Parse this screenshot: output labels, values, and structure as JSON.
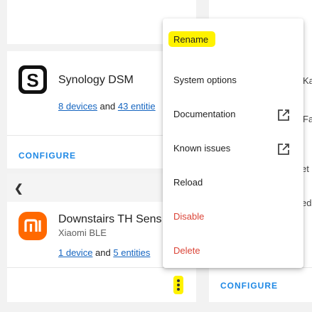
{
  "cards": {
    "synology": {
      "title": "Synology DSM",
      "devices_link": "8 devices",
      "and": "and",
      "entities_link": "43 entitie",
      "configure": "CONFIGURE"
    },
    "xiaomi": {
      "title": "Downstairs TH Sens",
      "subtitle": "Xiaomi BLE",
      "devices_link": "1 device",
      "and": "and",
      "entities_link": "5 entities"
    },
    "right": {
      "configure": "CONFIGURE",
      "fragments": [
        "Ka",
        "Fa",
        "et",
        "ed"
      ]
    }
  },
  "menu": {
    "items": [
      {
        "label": "Rename"
      },
      {
        "label": "System options"
      },
      {
        "label": "Documentation",
        "icon": "open-in-new-icon"
      },
      {
        "label": "Known issues",
        "icon": "open-in-new-icon"
      },
      {
        "label": "Reload"
      },
      {
        "label": "Disable",
        "danger": true
      },
      {
        "label": "Delete",
        "danger": true
      }
    ]
  },
  "colors": {
    "accent": "#1e88e5",
    "link": "#1565c0",
    "danger": "#db4437",
    "highlight": "#fff200",
    "xiaomi_brand": "#ff6900"
  }
}
